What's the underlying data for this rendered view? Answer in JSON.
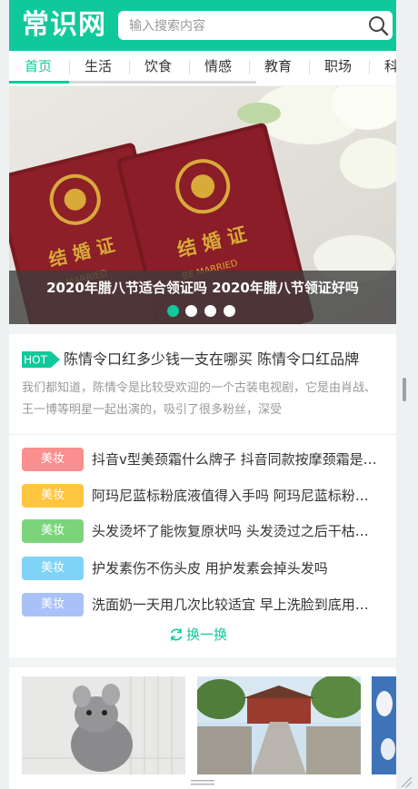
{
  "header": {
    "logo": "常识网",
    "search_placeholder": "输入搜索内容",
    "search_icon": "search-icon"
  },
  "nav": {
    "items": [
      "首页",
      "生活",
      "饮食",
      "情感",
      "教育",
      "职场",
      "科"
    ],
    "active": "首页"
  },
  "banner": {
    "caption": "2020年腊八节适合领证吗 2020年腊八节领证好吗",
    "slide_count": 4,
    "active_slide": 1
  },
  "hot": {
    "badge": "HOT",
    "title": "陈情令口红多少钱一支在哪买 陈情令口红品牌",
    "summary": "我们都知道，陈情令是比较受欢迎的一个古装电视剧，它是由肖战、王一博等明星一起出演的，吸引了很多粉丝，深受"
  },
  "list": [
    {
      "tag": "美妆",
      "title": "抖音v型美颈霜什么牌子 抖音同款按摩颈霜是什么",
      "color": "#fb8e8e"
    },
    {
      "tag": "美妆",
      "title": "阿玛尼蓝标粉底液值得入手吗 阿玛尼蓝标粉底液好用吗",
      "color": "#ffc53f"
    },
    {
      "tag": "美妆",
      "title": "头发烫坏了能恢复原状吗 头发烫过之后干枯怎么办",
      "color": "#7bd47b"
    },
    {
      "tag": "美妆",
      "title": "护发素伤不伤头皮 用护发素会掉头发吗",
      "color": "#7fd3f7"
    },
    {
      "tag": "美妆",
      "title": "洗面奶一天用几次比较适宜 早上洗脸到底用不用洗面奶",
      "color": "#a9c1f7"
    }
  ],
  "refresh_label": "换一换",
  "colors": {
    "accent": "#10c99b",
    "hot_badge": "#10c99b"
  }
}
